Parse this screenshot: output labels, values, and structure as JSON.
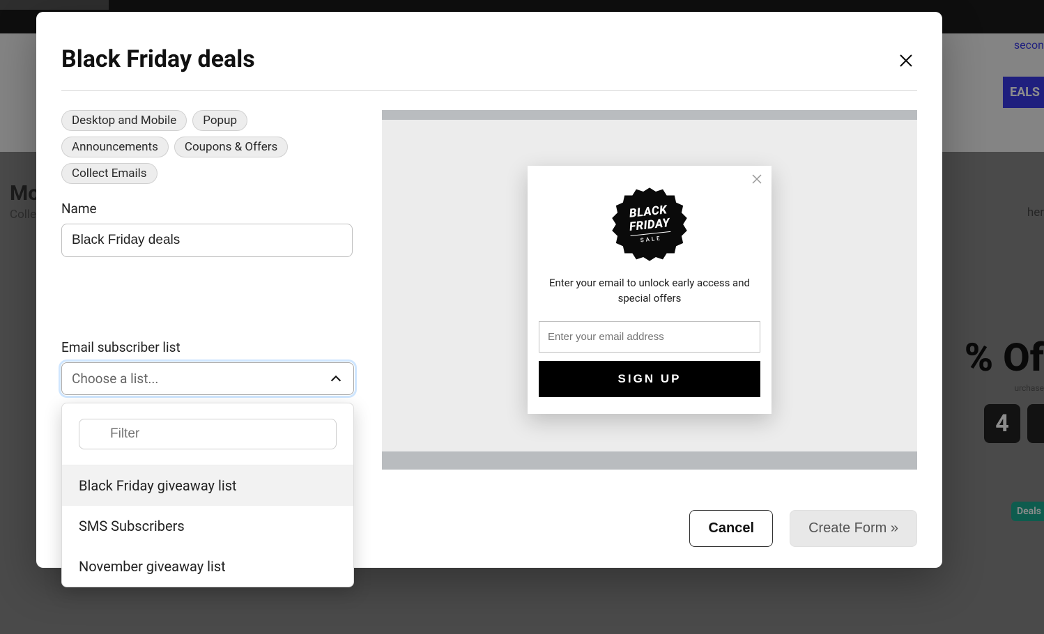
{
  "modal": {
    "title": "Black Friday deals"
  },
  "tags": [
    "Desktop and Mobile",
    "Popup",
    "Announcements",
    "Coupons & Offers",
    "Collect Emails"
  ],
  "name_field": {
    "label": "Name",
    "value": "Black Friday deals"
  },
  "list_field": {
    "label": "Email subscriber list",
    "placeholder": "Choose a list...",
    "filter_placeholder": "Filter",
    "options": [
      "Black Friday giveaway list",
      "SMS Subscribers",
      "November giveaway list"
    ]
  },
  "preview": {
    "badge_line1": "BLACK",
    "badge_line2": "FRIDAY",
    "badge_line3": "SALE",
    "description": "Enter your email to unlock early access and special offers",
    "email_placeholder": "Enter your email address",
    "cta": "SIGN UP"
  },
  "actions": {
    "cancel": "Cancel",
    "create": "Create Form »"
  },
  "bg": {
    "mo": "Mo",
    "colle": "Colle",
    "secon": "secon",
    "eals": "EALS",
    "ol": "% Of",
    "ur": "urchase",
    "four": "4",
    "deals": "Deals",
    "her": "her"
  }
}
